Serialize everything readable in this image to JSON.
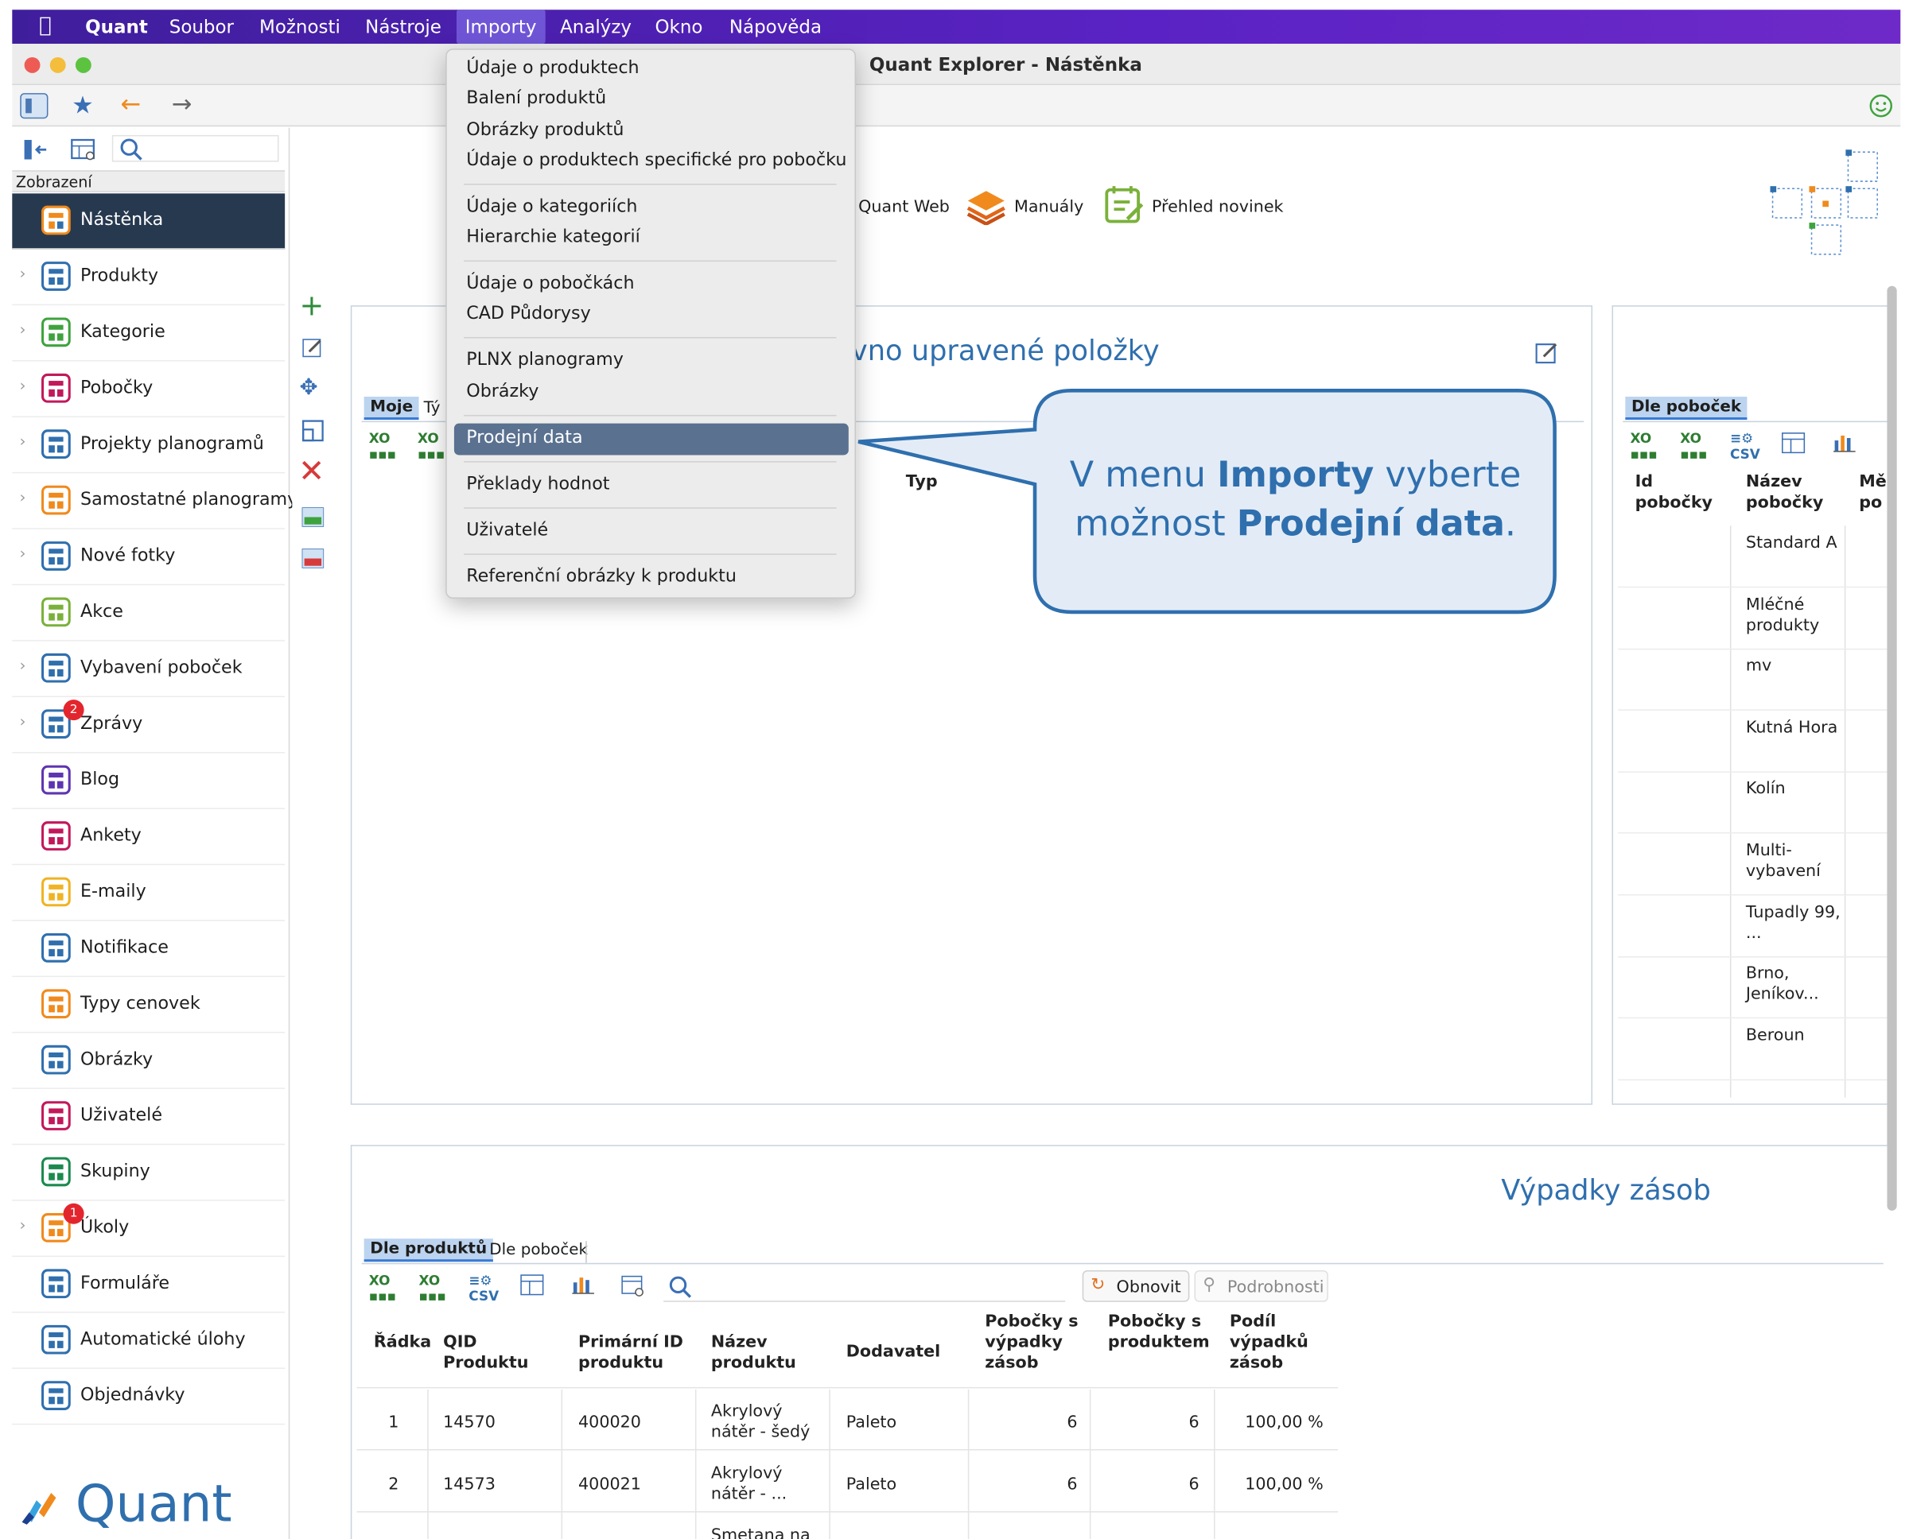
{
  "menubar": {
    "items": [
      "Quant",
      "Soubor",
      "Možnosti",
      "Nástroje",
      "Importy",
      "Analýzy",
      "Okno",
      "Nápověda"
    ]
  },
  "window": {
    "title": "Quant Explorer - Nástěnka"
  },
  "sidebar": {
    "section_label": "Zobrazení",
    "items": [
      {
        "label": "Nástěnka"
      },
      {
        "label": "Produkty"
      },
      {
        "label": "Kategorie"
      },
      {
        "label": "Pobočky"
      },
      {
        "label": "Projekty planogramů"
      },
      {
        "label": "Samostatné planogramy"
      },
      {
        "label": "Nové fotky"
      },
      {
        "label": "Akce"
      },
      {
        "label": "Vybavení poboček"
      },
      {
        "label": "Zprávy",
        "badge": "2"
      },
      {
        "label": "Blog"
      },
      {
        "label": "Ankety"
      },
      {
        "label": "E-maily"
      },
      {
        "label": "Notifikace"
      },
      {
        "label": "Typy cenovek"
      },
      {
        "label": "Obrázky"
      },
      {
        "label": "Uživatelé"
      },
      {
        "label": "Skupiny"
      },
      {
        "label": "Úkoly",
        "badge": "1"
      },
      {
        "label": "Formuláře"
      },
      {
        "label": "Automatické úlohy"
      },
      {
        "label": "Objednávky"
      }
    ],
    "logo_text": "Quant"
  },
  "links": {
    "web": "Quant Web",
    "manuals": "Manuály",
    "news": "Přehled novinek"
  },
  "recent_panel": {
    "title": "Naposledy upravené položky",
    "title_visible": "vno upravené položky",
    "tab_mine": "Moje",
    "tab_team": "Tý",
    "col_type": "Typ"
  },
  "branch_panel": {
    "tab": "Dle poboček",
    "col_id": "Id pobočky",
    "col_name": "Název pobočky",
    "col_cut": "Mě po",
    "names": [
      "Standard A",
      "Mléčné produkty",
      "mv",
      "Kutná Hora",
      "Kolín",
      "Multi-vybavení",
      "Tupadly 99, ...",
      "Brno, Jeníkov...",
      "Beroun"
    ]
  },
  "stockout_panel": {
    "title": "Výpadky zásob",
    "tab_products": "Dle produktů",
    "tab_branches": "Dle poboček",
    "refresh": "Obnovit",
    "details": "Podrobnosti",
    "headers": [
      "Řádka",
      "QID Produktu",
      "Primární ID produktu",
      "Název produktu",
      "Dodavatel",
      "Pobočky s výpadky zásob",
      "Pobočky s produktem",
      "Podíl výpadků zásob"
    ],
    "rows": [
      [
        "1",
        "14570",
        "400020",
        "Akrylový nátěr - šedý",
        "Paleto",
        "6",
        "6",
        "100,00 %"
      ],
      [
        "2",
        "14573",
        "400021",
        "Akrylový nátěr - ...",
        "Paleto",
        "6",
        "6",
        "100,00 %"
      ],
      [
        "",
        "",
        "",
        "Smetana na",
        "",
        "",
        "",
        ""
      ]
    ]
  },
  "dropdown": {
    "items": [
      "Údaje o produktech",
      "Balení produktů",
      "Obrázky produktů",
      "Údaje o produktech specifické pro pobočku",
      "Údaje o kategoriích",
      "Hierarchie kategorií",
      "Údaje o pobočkách",
      "CAD Půdorysy",
      "PLNX planogramy",
      "Obrázky",
      "Prodejní data",
      "Překlady hodnot",
      "Uživatelé",
      "Referenční obrázky k produktu"
    ],
    "highlighted": "Prodejní data"
  },
  "callout": {
    "pre": "V menu ",
    "menu": "Importy",
    "mid": " vyberte možnost ",
    "option": "Prodejní data",
    "post": "."
  },
  "colors": {
    "menubar": "#4b21b3",
    "accent": "#2f6fae",
    "highlight": "#5a7190",
    "callout_border": "#2f6fae",
    "callout_fill": "#e3ecf6"
  }
}
